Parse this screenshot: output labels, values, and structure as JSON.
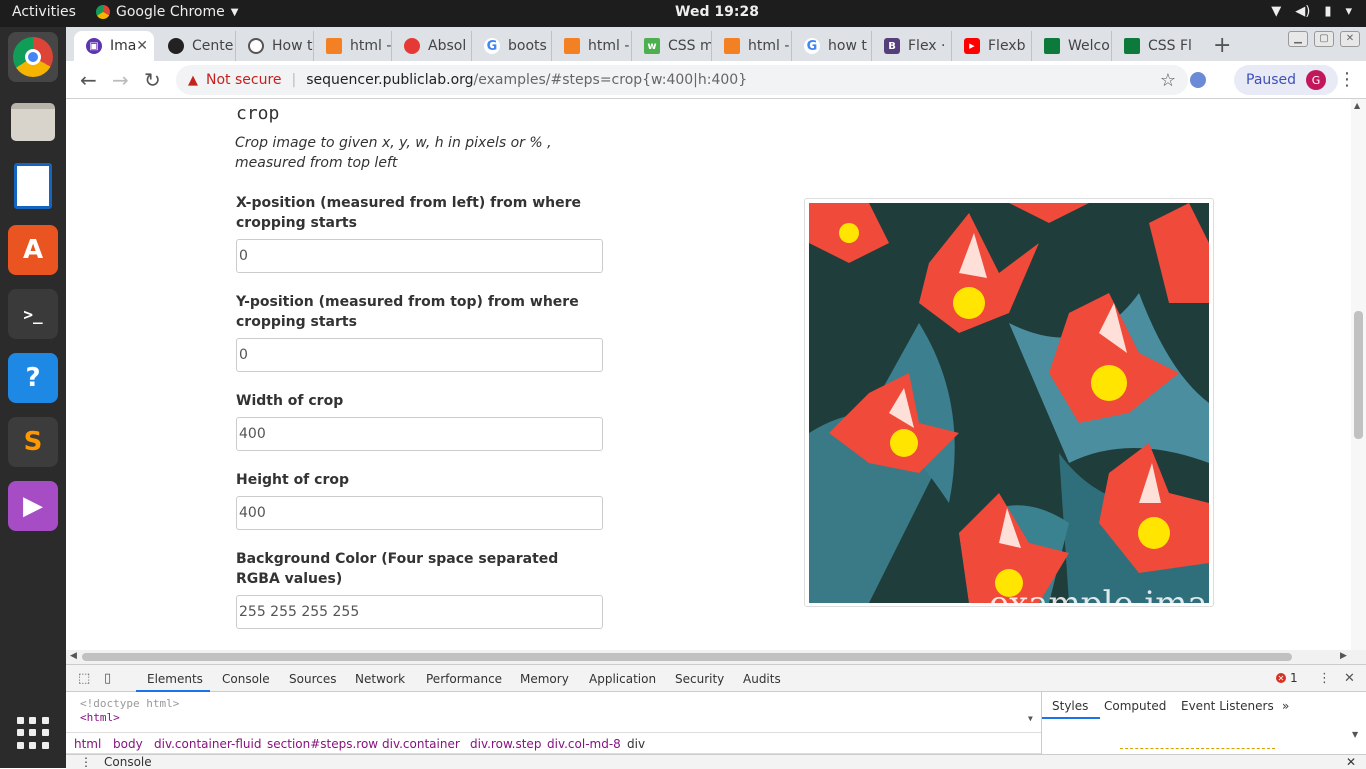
{
  "system": {
    "activities": "Activities",
    "app_name": "Google Chrome",
    "clock": "Wed 19:28"
  },
  "dock": [
    "chrome-icon",
    "files-icon",
    "writer-icon",
    "software-icon",
    "terminal-icon",
    "help-icon",
    "sublime-icon",
    "media-icon",
    "apps-grid-icon"
  ],
  "tabs": [
    {
      "label": "Ima",
      "fav_color": "#5e35b1"
    },
    {
      "label": "Cente",
      "fav_color": "#222222"
    },
    {
      "label": "How t",
      "fav_color": "#555555"
    },
    {
      "label": "html -",
      "fav_color": "#f48024"
    },
    {
      "label": "Absol",
      "fav_color": "#e53935"
    },
    {
      "label": "boots",
      "fav_color": "#4285f4"
    },
    {
      "label": "html -",
      "fav_color": "#f48024"
    },
    {
      "label": "CSS m",
      "fav_color": "#4caf50"
    },
    {
      "label": "html -",
      "fav_color": "#f48024"
    },
    {
      "label": "how t",
      "fav_color": "#4285f4"
    },
    {
      "label": "Flex ·",
      "fav_color": "#563d7c"
    },
    {
      "label": "Flexb",
      "fav_color": "#ff0000"
    },
    {
      "label": "Welco",
      "fav_color": "#0b7a3b"
    },
    {
      "label": "CSS Fl",
      "fav_color": "#0b7a3b"
    }
  ],
  "address": {
    "security": "Not secure",
    "host": "sequencer.publiclab.org",
    "path": "/examples/#steps=crop{w:400|h:400}"
  },
  "profile": {
    "label": "Paused",
    "initial": "G"
  },
  "page": {
    "title": "crop",
    "description": "Crop image to given x, y, w, h in pixels or % , measured from top left",
    "fields": [
      {
        "label": "X-position (measured from left) from where cropping starts",
        "value": "0"
      },
      {
        "label": "Y-position (measured from top) from where cropping starts",
        "value": "0"
      },
      {
        "label": "Width of crop",
        "value": "400"
      },
      {
        "label": "Height of crop",
        "value": "400"
      },
      {
        "label": "Background Color (Four space separated RGBA values)",
        "value": "255 255 255 255"
      }
    ],
    "image_overlay_text": "example ima"
  },
  "devtools": {
    "tabs": [
      "Elements",
      "Console",
      "Sources",
      "Network",
      "Performance",
      "Memory",
      "Application",
      "Security",
      "Audits"
    ],
    "error_count": "1",
    "dom": {
      "doctype": "<!doctype html>",
      "html": "<html>"
    },
    "breadcrumbs": [
      "html",
      "body",
      "div.container-fluid",
      "section#steps.row",
      "div.container",
      "div.row.step",
      "div.col-md-8",
      "div"
    ],
    "style_tabs": [
      "Styles",
      "Computed",
      "Event Listeners"
    ],
    "drawer": "Console"
  }
}
